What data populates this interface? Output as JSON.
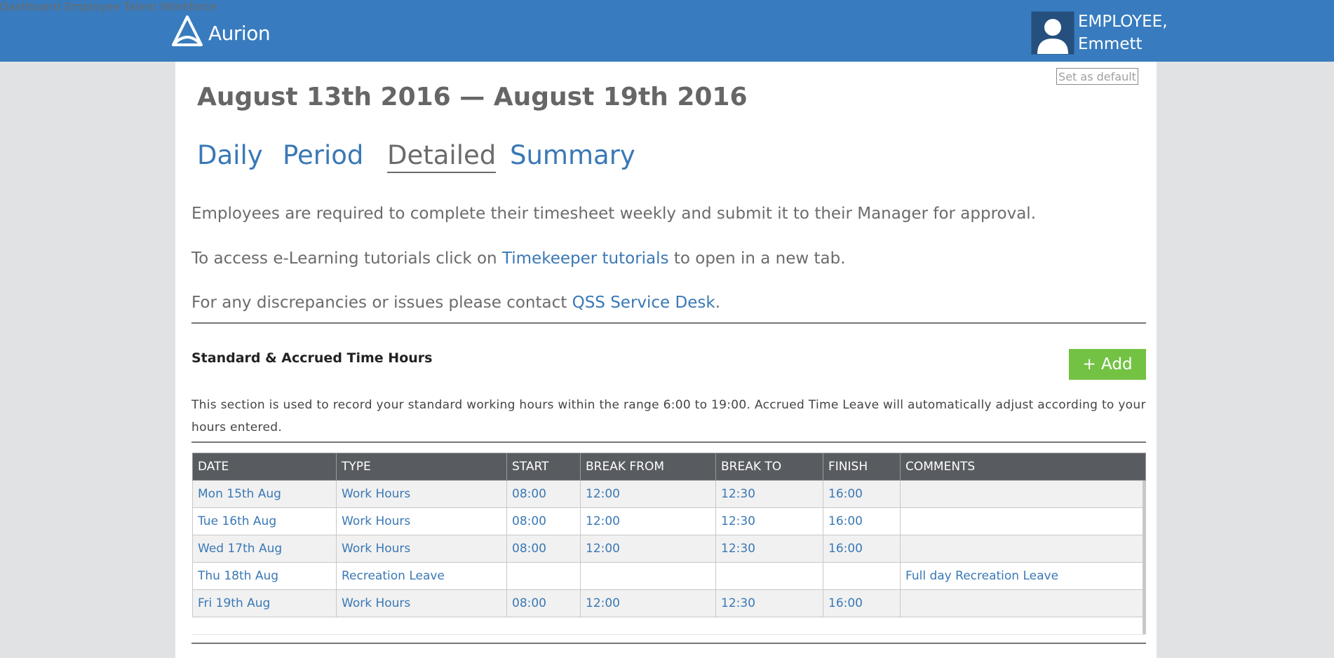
{
  "header": {
    "brand_text": "Aurion",
    "nav": [
      "Dashboard",
      "Employee",
      "Talent",
      "Workforce"
    ],
    "user_line1": "EMPLOYEE,",
    "user_line2": "Emmett"
  },
  "set_default_label": "Set as default",
  "page_title": "August 13th 2016 — August 19th 2016",
  "tabs": [
    {
      "label": "Daily",
      "active": false
    },
    {
      "label": "Period",
      "active": false
    },
    {
      "label": "Detailed",
      "active": true
    },
    {
      "label": "Summary",
      "active": false
    }
  ],
  "info": {
    "line1": "Employees are required to complete their timesheet weekly and submit it to their Manager for approval.",
    "line2_pre": "To access e-Learning tutorials click on ",
    "line2_link": "Timekeeper tutorials",
    "line2_post": " to open in a new tab.",
    "line3_pre": "For any discrepancies or issues please contact ",
    "line3_link": "QSS Service Desk",
    "line3_post": "."
  },
  "section": {
    "title": "Standard & Accrued Time Hours",
    "add_label": "+ Add",
    "description": "This section is used to record your standard working hours within the range 6:00 to 19:00. Accrued Time Leave will automatically adjust according to your hours entered."
  },
  "table": {
    "headers": [
      "DATE",
      "TYPE",
      "START",
      "BREAK FROM",
      "BREAK TO",
      "FINISH",
      "COMMENTS"
    ],
    "rows": [
      [
        "Mon 15th Aug",
        "Work Hours",
        "08:00",
        "12:00",
        "12:30",
        "16:00",
        ""
      ],
      [
        "Tue 16th Aug",
        "Work Hours",
        "08:00",
        "12:00",
        "12:30",
        "16:00",
        ""
      ],
      [
        "Wed 17th Aug",
        "Work Hours",
        "08:00",
        "12:00",
        "12:30",
        "16:00",
        ""
      ],
      [
        "Thu 18th Aug",
        "Recreation Leave",
        "",
        "",
        "",
        "",
        "Full day Recreation Leave"
      ],
      [
        "Fri 19th Aug",
        "Work Hours",
        "08:00",
        "12:00",
        "12:30",
        "16:00",
        ""
      ]
    ]
  },
  "colors": {
    "header_bg": "#387cbf",
    "link": "#3a78b5",
    "add_button": "#73c243",
    "table_header": "#585c60"
  },
  "icons": [
    "aurion-logo-icon",
    "user-avatar-icon"
  ]
}
